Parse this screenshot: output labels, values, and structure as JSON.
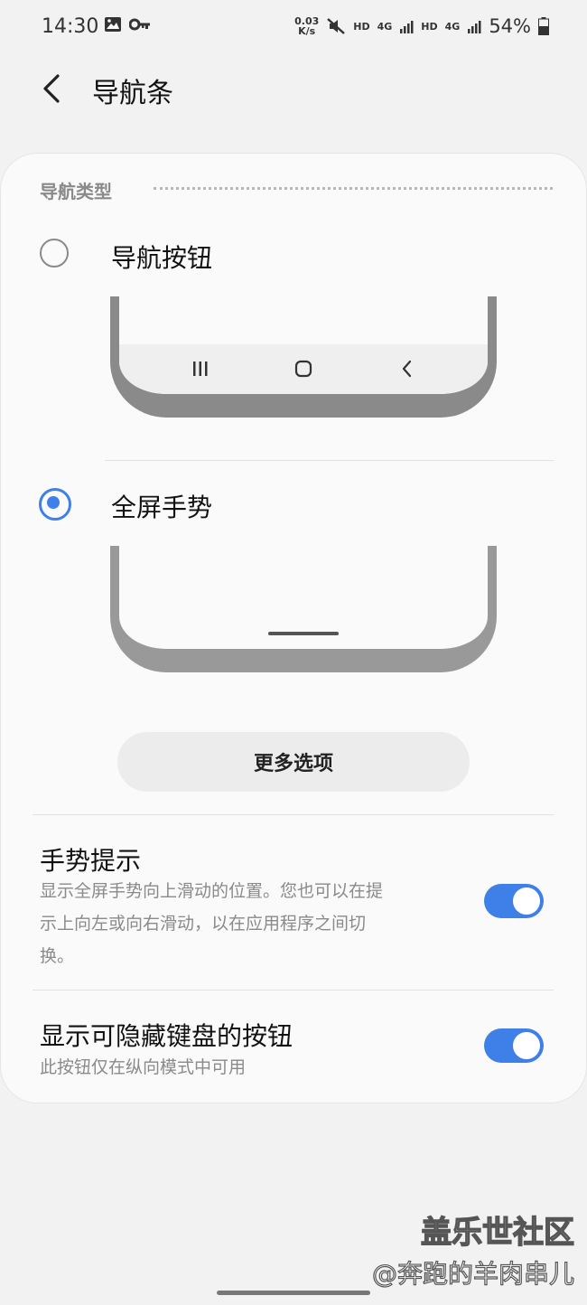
{
  "status_bar": {
    "time": "14:30",
    "net_speed_top": "0.03",
    "net_speed_bottom": "K/s",
    "hd1": "HD",
    "hd2": "HD",
    "sig1": "4G",
    "sig2": "4G",
    "battery": "54%"
  },
  "appbar": {
    "title": "导航条"
  },
  "section": {
    "header": "导航类型"
  },
  "options": [
    {
      "label": "导航按钮",
      "selected": false
    },
    {
      "label": "全屏手势",
      "selected": true
    }
  ],
  "more_button": "更多选项",
  "settings": [
    {
      "title": "手势提示",
      "desc_lines": [
        "显示全屏手势向上滑动的位置。您也可以在提",
        "示上向左或向右滑动，以在应用程序之间切",
        "换。"
      ],
      "enabled": true
    },
    {
      "title": "显示可隐藏键盘的按钮",
      "desc_lines": [
        "此按钮仅在纵向模式中可用"
      ],
      "enabled": true
    }
  ],
  "watermark": {
    "line1": "盖乐世社区",
    "line2": "@奔跑的羊肉串儿"
  },
  "colors": {
    "accent": "#3e80e8",
    "frame": "#8a8a8a"
  }
}
